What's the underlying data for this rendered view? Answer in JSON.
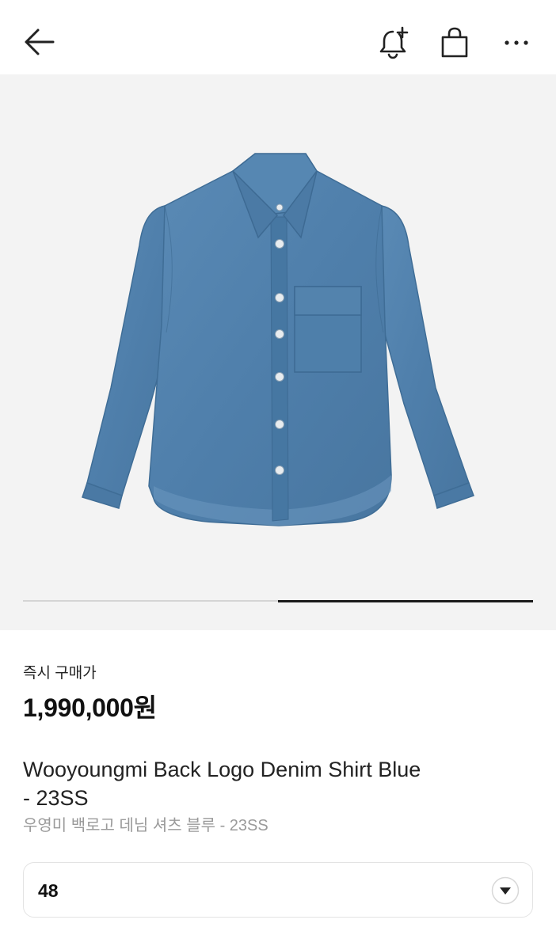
{
  "header": {
    "back_icon": "arrow-left-icon",
    "alert_icon": "bell-plus-icon",
    "bag_icon": "shopping-bag-icon",
    "more_icon": "more-horizontal-icon"
  },
  "gallery": {
    "image": "denim-shirt-photo",
    "current_index": 2,
    "total_images": 2
  },
  "product": {
    "price_label": "즉시 구매가",
    "price": "1,990,000원",
    "title_line1": "Wooyoungmi Back Logo Denim Shirt Blue",
    "title_line2": "- 23SS",
    "subtitle": "우영미 백로고 데님 셔츠 블루 - 23SS"
  },
  "size_select": {
    "value": "48",
    "icon": "chevron-down-circle-icon"
  },
  "colors": {
    "accent": "#111111",
    "denim": "#4f7fa9",
    "muted_text": "#9a9a9a"
  }
}
